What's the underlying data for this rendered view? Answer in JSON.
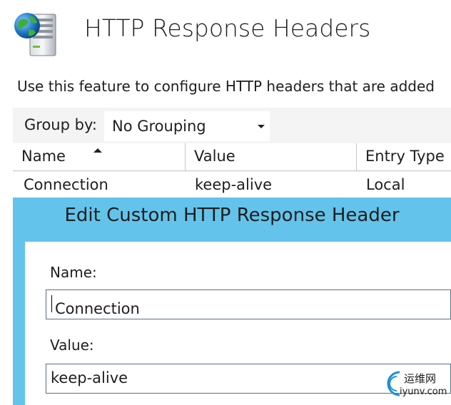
{
  "page": {
    "title": "HTTP Response Headers",
    "description": "Use this feature to configure HTTP headers that are added"
  },
  "toolbar": {
    "group_by_label": "Group by:",
    "group_by_value": "No Grouping"
  },
  "table": {
    "columns": [
      "Name",
      "Value",
      "Entry Type"
    ],
    "sort_column": "Name",
    "sort_direction": "ascending",
    "rows": [
      {
        "name": "Connection",
        "value": "keep-alive",
        "entry_type": "Local"
      }
    ]
  },
  "dialog": {
    "title": "Edit Custom HTTP Response Header",
    "name_label": "Name:",
    "name_value": "Connection",
    "value_label": "Value:",
    "value_value": "keep-alive"
  },
  "watermark": {
    "text_cn": "运维网",
    "text_en": "iyunv.com"
  },
  "colors": {
    "dialog_border": "#63c3ea",
    "panel_background": "#f4f4f4"
  },
  "icons": {
    "page_icon": "globe-server-icon",
    "sort_icon": "sort-ascending-icon",
    "dropdown_icon": "chevron-down-icon"
  }
}
